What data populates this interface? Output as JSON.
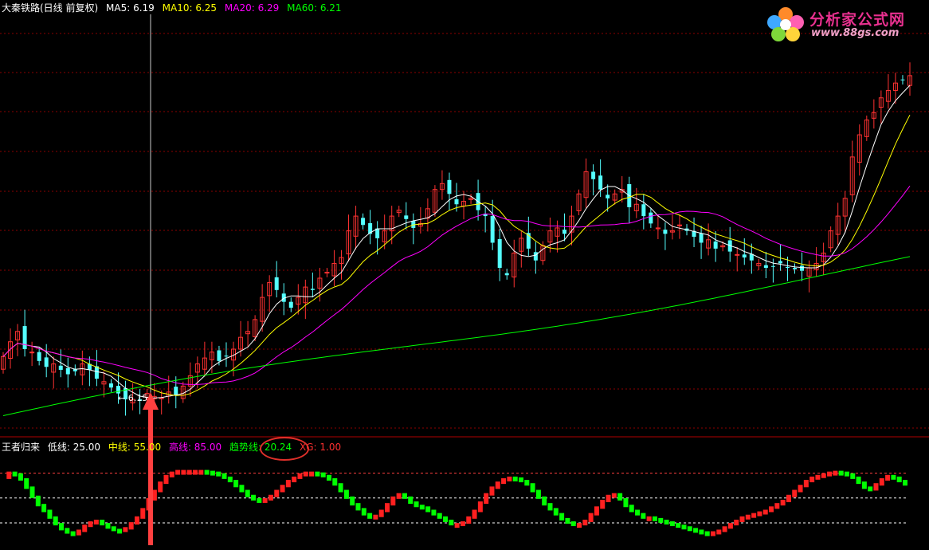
{
  "header": {
    "stock_title": "大秦铁路(日线 前复权)",
    "ma5": "MA5: 6.19",
    "ma10": "MA10: 6.25",
    "ma20": "MA20: 6.29",
    "ma60": "MA60: 6.21"
  },
  "indicator_header": {
    "name": "王者归来",
    "low": "低线: 25.00",
    "mid": "中线: 55.00",
    "high": "高线: 85.00",
    "trend": "趋势线: 20.24",
    "xg": "XG: 1.00"
  },
  "logo": {
    "title": "分析家公式网",
    "url": "www.88gs.com"
  },
  "colors": {
    "up": "#ff3232",
    "down": "#54ffff",
    "ma5": "#ffffff",
    "ma10": "#ffff00",
    "ma20": "#ff00ff",
    "ma60": "#00ff00",
    "grid": "#8b0000",
    "ind_up": "#ff2020",
    "ind_down": "#00ff00",
    "arrow": "#ff4040"
  },
  "chart_data": [
    {
      "type": "candlestick",
      "title": "大秦铁路(日线 前复权)",
      "annotations": [
        {
          "text": "6.15",
          "kind": "low-price-marker"
        }
      ],
      "series": [
        {
          "name": "MA5",
          "last": 6.19
        },
        {
          "name": "MA10",
          "last": 6.25
        },
        {
          "name": "MA20",
          "last": 6.29
        },
        {
          "name": "MA60",
          "last": 6.21
        }
      ]
    },
    {
      "type": "bar",
      "title": "王者归来",
      "levels": {
        "low": 25.0,
        "mid": 55.0,
        "high": 85.0
      },
      "ylim": [
        0,
        100
      ],
      "trend_last": 20.24,
      "xg": 1.0,
      "trend_series": [
        78,
        84,
        82,
        76,
        66,
        55,
        45,
        38,
        30,
        22,
        16,
        12,
        10,
        14,
        20,
        24,
        26,
        22,
        18,
        15,
        14,
        17,
        23,
        30,
        40,
        52,
        62,
        72,
        80,
        84,
        86,
        86,
        86,
        86,
        86,
        85,
        84,
        82,
        78,
        74,
        68,
        62,
        56,
        52,
        50,
        52,
        56,
        62,
        68,
        74,
        78,
        82,
        84,
        84,
        83,
        80,
        76,
        70,
        62,
        54,
        46,
        40,
        34,
        30,
        32,
        38,
        46,
        54,
        58,
        54,
        48,
        44,
        42,
        38,
        34,
        30,
        26,
        22,
        22,
        24,
        30,
        38,
        48,
        58,
        66,
        72,
        76,
        78,
        77,
        74,
        70,
        62,
        54,
        46,
        40,
        34,
        28,
        24,
        22,
        22,
        26,
        34,
        42,
        50,
        56,
        58,
        52,
        44,
        38,
        34,
        30,
        30,
        28,
        26,
        24,
        22,
        20,
        18,
        16,
        14,
        12,
        11,
        12,
        14,
        18,
        22,
        26,
        30,
        32,
        34,
        36,
        38,
        42,
        46,
        50,
        56,
        62,
        68,
        74,
        78,
        80,
        82,
        84,
        85,
        84,
        82,
        78,
        72,
        66,
        64,
        70,
        76,
        80,
        78,
        74,
        70
      ]
    }
  ]
}
